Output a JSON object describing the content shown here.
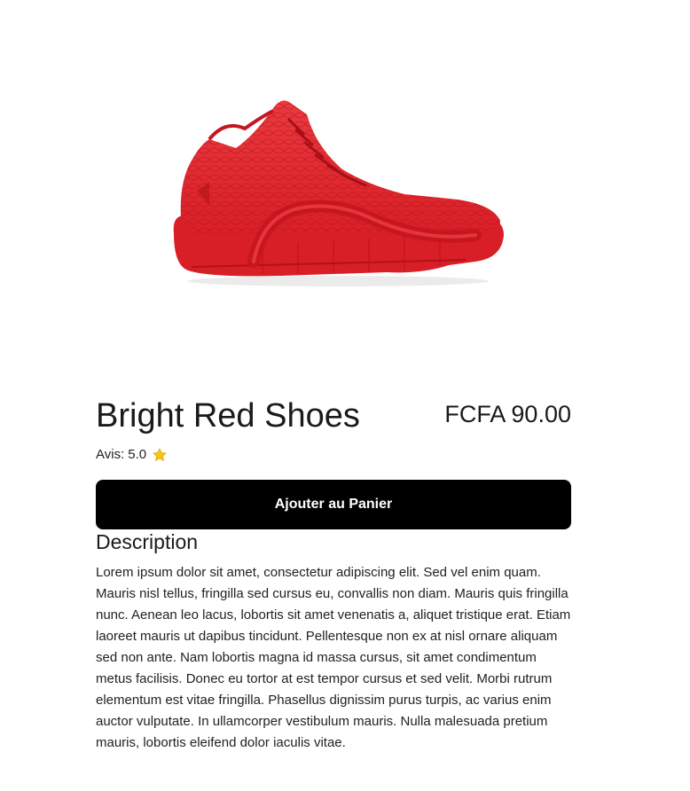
{
  "product": {
    "image_icon": "red-basketball-shoe",
    "title": "Bright Red Shoes",
    "price": "FCFA 90.00",
    "rating_label": "Avis:",
    "rating_value": "5.0",
    "rating_icon": "star-icon",
    "accent_color": "#f5c518",
    "shoe_color": "#e2262d"
  },
  "actions": {
    "add_to_cart_label": "Ajouter au Panier"
  },
  "description": {
    "heading": "Description",
    "body": "Lorem ipsum dolor sit amet, consectetur adipiscing elit. Sed vel enim quam. Mauris nisl tellus, fringilla sed cursus eu, convallis non diam. Mauris quis fringilla nunc. Aenean leo lacus, lobortis sit amet venenatis a, aliquet tristique erat. Etiam laoreet mauris ut dapibus tincidunt. Pellentesque non ex at nisl ornare aliquam sed non ante. Nam lobortis magna id massa cursus, sit amet condimentum metus facilisis. Donec eu tortor at est tempor cursus et sed velit. Morbi rutrum elementum est vitae fringilla. Phasellus dignissim purus turpis, ac varius enim auctor vulputate. In ullamcorper vestibulum mauris. Nulla malesuada pretium mauris, lobortis eleifend dolor iaculis vitae."
  }
}
